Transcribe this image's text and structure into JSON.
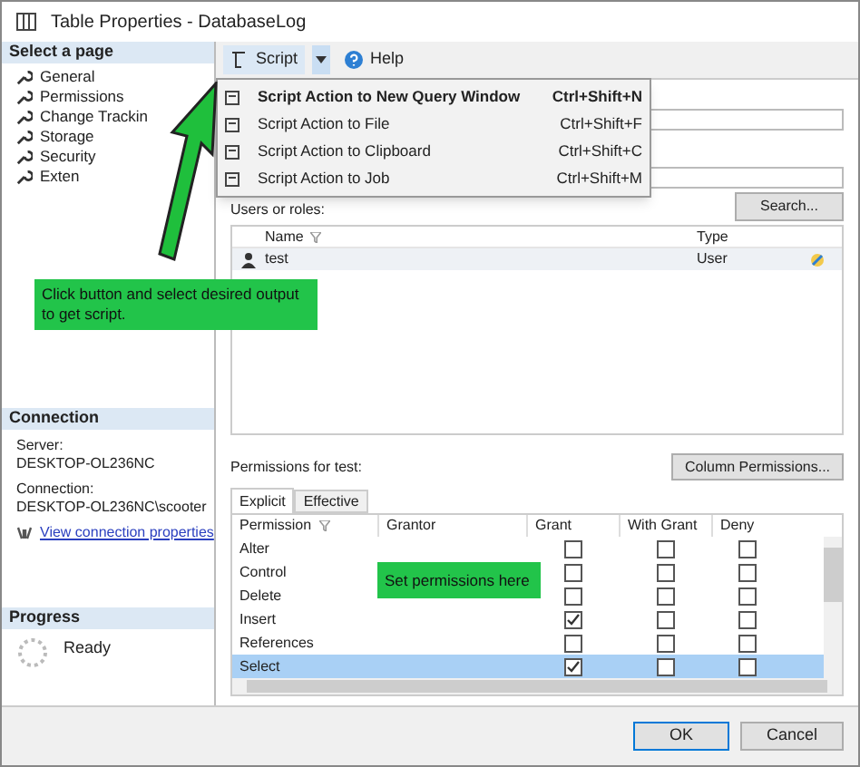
{
  "window": {
    "title": "Table Properties - DatabaseLog"
  },
  "sidebar": {
    "header": "Select a page",
    "items": [
      {
        "label": "General"
      },
      {
        "label": "Permissions"
      },
      {
        "label": "Change Trackin"
      },
      {
        "label": "Storage"
      },
      {
        "label": "Security"
      },
      {
        "label": "Exten"
      }
    ]
  },
  "connection": {
    "header": "Connection",
    "server_label": "Server:",
    "server": "DESKTOP-OL236NC",
    "connection_label": "Connection:",
    "connection": "DESKTOP-OL236NC\\scooter",
    "link": "View connection properties"
  },
  "progress": {
    "header": "Progress",
    "status": "Ready"
  },
  "toolbar": {
    "script": "Script",
    "help": "Help"
  },
  "script_menu": [
    {
      "label": "Script Action to New Query Window",
      "shortcut": "Ctrl+Shift+N",
      "default": true
    },
    {
      "label": "Script Action to File",
      "shortcut": "Ctrl+Shift+F",
      "default": false
    },
    {
      "label": "Script Action to Clipboard",
      "shortcut": "Ctrl+Shift+C",
      "default": false
    },
    {
      "label": "Script Action to Job",
      "shortcut": "Ctrl+Shift+M",
      "default": false
    }
  ],
  "users": {
    "label": "Users or roles:",
    "search": "Search...",
    "columns": [
      "Name",
      "Type"
    ],
    "rows": [
      {
        "name": "test",
        "type": "User"
      }
    ]
  },
  "callouts": [
    {
      "text": "Click button and select desired output to get script."
    }
  ],
  "permissions": {
    "label": "Permissions for test:",
    "column_permissions": "Column Permissions...",
    "tabs": [
      {
        "label": "Explicit",
        "selected": true
      },
      {
        "label": "Effective",
        "selected": false
      }
    ],
    "columns": [
      "Permission",
      "Grantor",
      "Grant",
      "With Grant",
      "Deny"
    ],
    "rows": [
      {
        "permission": "Alter",
        "grant": false,
        "with_grant": false,
        "deny": false,
        "selected": false
      },
      {
        "permission": "Control",
        "grant": false,
        "with_grant": false,
        "deny": false,
        "selected": false,
        "note": "Set permissions here"
      },
      {
        "permission": "Delete",
        "grant": false,
        "with_grant": false,
        "deny": false,
        "selected": false
      },
      {
        "permission": "Insert",
        "grant": true,
        "with_grant": false,
        "deny": false,
        "selected": false
      },
      {
        "permission": "References",
        "grant": false,
        "with_grant": false,
        "deny": false,
        "selected": false
      },
      {
        "permission": "Select",
        "grant": true,
        "with_grant": false,
        "deny": false,
        "selected": true
      }
    ]
  },
  "buttons": [
    "OK",
    "Cancel"
  ]
}
